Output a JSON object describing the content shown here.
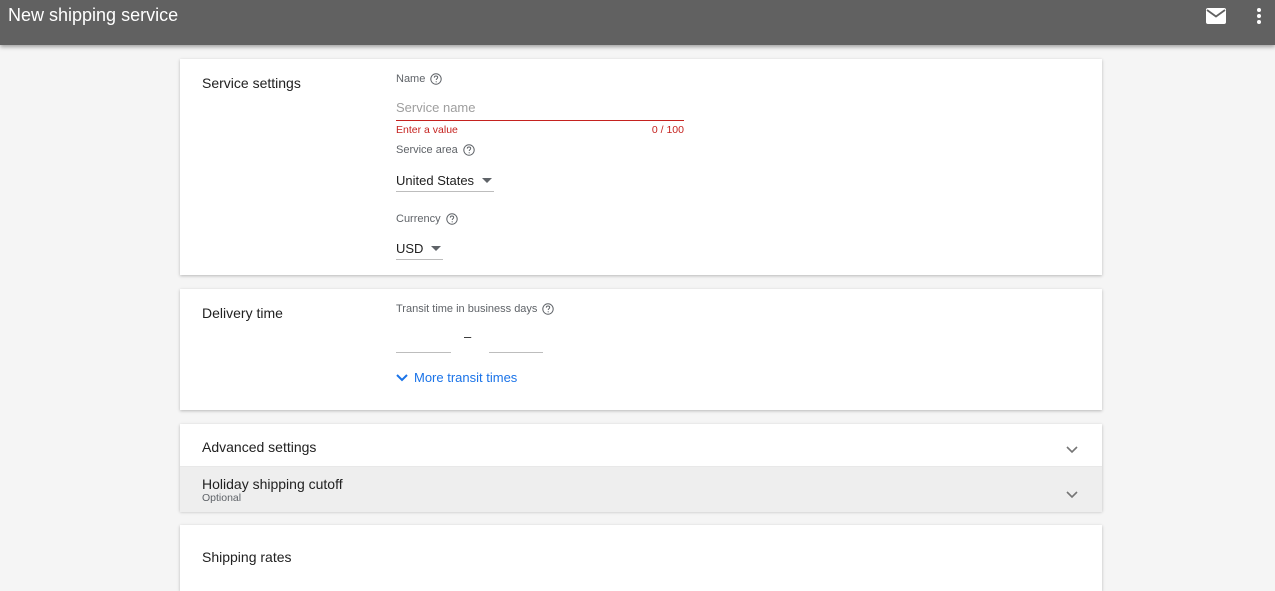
{
  "header": {
    "title": "New shipping service",
    "mail_icon": "mail-icon",
    "more_icon": "more-vert-icon",
    "background": "#616161"
  },
  "service_settings": {
    "title": "Service settings",
    "name": {
      "label": "Name",
      "placeholder": "Service name",
      "value": "",
      "error": "Enter a value",
      "counter": "0 / 100"
    },
    "service_area": {
      "label": "Service area",
      "selected": "United States"
    },
    "currency": {
      "label": "Currency",
      "selected": "USD"
    }
  },
  "delivery_time": {
    "title": "Delivery time",
    "transit_label": "Transit time in business days",
    "min_value": "",
    "max_value": "",
    "separator": "–",
    "more_link": "More transit times"
  },
  "advanced_settings": {
    "title": "Advanced settings"
  },
  "holiday_cutoff": {
    "title": "Holiday shipping cutoff",
    "subtitle": "Optional"
  },
  "shipping_rates": {
    "title": "Shipping rates"
  },
  "colors": {
    "error": "#c5221f",
    "link": "#1a73e8"
  }
}
